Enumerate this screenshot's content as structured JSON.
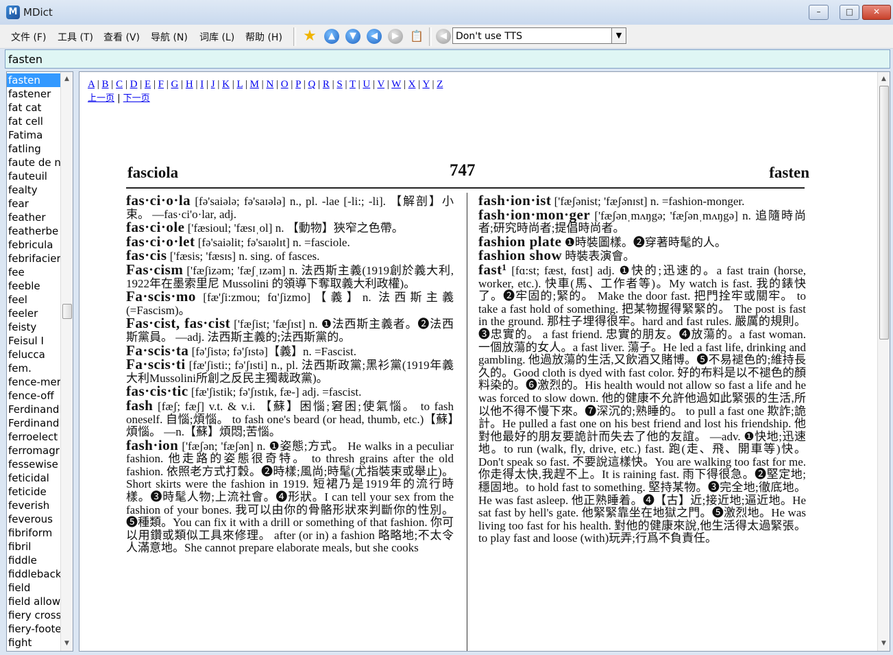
{
  "window": {
    "title": "MDict",
    "app_icon_glyph": "M"
  },
  "menu": [
    {
      "label": "文件 (F)"
    },
    {
      "label": "工具 (T)"
    },
    {
      "label": "查看 (V)"
    },
    {
      "label": "导航 (N)"
    },
    {
      "label": "词库 (L)"
    },
    {
      "label": "帮助 (H)"
    }
  ],
  "toolbar": {
    "tts_selected": "Don't use TTS"
  },
  "search": {
    "value": "fasten"
  },
  "wordlist": [
    "fasten",
    "fastener",
    "fat cat",
    "fat cell",
    "Fatima",
    "fatling",
    "faute de n",
    "fauteuil",
    "fealty",
    "fear",
    "feather",
    "featherbe",
    "febricula",
    "febrifacier",
    "fee",
    "feeble",
    "feel",
    "feeler",
    "feisty",
    "Feisul I",
    "felucca",
    "fem.",
    "fence-mer",
    "fence-off",
    "Ferdinand",
    "Ferdinand",
    "ferroelect",
    "ferromagr",
    "fessewise",
    "feticidal",
    "feticide",
    "feverish",
    "feverous",
    "fibriform",
    "fibril",
    "fiddle",
    "fiddleback",
    "field",
    "field allow",
    "fiery cross",
    "fiery-foote",
    "fight"
  ],
  "alphabet": [
    "A",
    "B",
    "C",
    "D",
    "E",
    "F",
    "G",
    "H",
    "I",
    "J",
    "K",
    "L",
    "M",
    "N",
    "O",
    "P",
    "Q",
    "R",
    "S",
    "T",
    "U",
    "V",
    "W",
    "X",
    "Y",
    "Z"
  ],
  "pager": {
    "prev": "上一页",
    "next": "下一页"
  },
  "page": {
    "header_left": "fasciola",
    "page_number": "747",
    "header_right": "fasten",
    "left_column": [
      {
        "hw": "fas·ci·o·la",
        "t": " [fə'saiələ; fə'saɪələ] n., pl. -lae [-li:; -li]. 【解剖】小束。 —fas·ci'o·lar, adj."
      },
      {
        "hw": "fas·ci·ole",
        "t": " ['fæsioul; 'fæsɪˌol] n. 【動物】狹窄之色帶。"
      },
      {
        "hw": "fas·ci·o·let",
        "t": " [fə'saiəlit; fə'saɪəlɪt] n. =fasciole."
      },
      {
        "hw": "fas·cis",
        "t": " ['fæsis; 'fæsɪs] n. sing. of fasces."
      },
      {
        "hw": "Fas·cism",
        "t": " ['fæʃizəm; 'fæʃˌɪzəm] n. 法西斯主義(1919創於義大利, 1922年在墨索里尼 Mussolini 的領導下奪取義大利政權)。"
      },
      {
        "hw": "Fa·scis·mo",
        "t": " [fæ'ʃi:zmou; fɑ'ʃizmo]【義】n. 法西斯主義 (=Fascism)。"
      },
      {
        "hw": "Fas·cist, fas·cist",
        "t": " ['fæʃist; 'fæʃɪst] n. ❶法西斯主義者。❷法西斯黨員。 —adj. 法西斯主義的;法西斯黨的。"
      },
      {
        "hw": "Fa·scis·ta",
        "t": " [fə'ʃistə; fə'ʃɪstə]【義】n. =Fascist."
      },
      {
        "hw": "Fa·scis·ti",
        "t": " [fæ'ʃisti:; fə'ʃɪsti] n., pl. 法西斯政黨;黑衫黨(1919年義大利Mussolini所創之反民主獨裁政黨)。"
      },
      {
        "hw": "fas·cis·tic",
        "t": " [fæ'ʃistik; fə'ʃɪstɪk, fæ-] adj. =fascist."
      },
      {
        "hw": "fash",
        "t": " [fæʃ; fæʃ] v.t. & v.i. 【蘇】困惱;窘困;使氣惱。 to fash oneself. 自惱;煩惱。 to fash one's beard (or head, thumb, etc.)【蘇】煩惱。 —n.【蘇】煩悶;苦惱。"
      },
      {
        "hw": "fash·ion",
        "t": " ['fæʃən; 'fæʃən] n. ❶姿態;方式。 He walks in a peculiar fashion. 他走路的姿態很奇特。 to thresh grains after the old fashion. 依照老方式打穀。❷時樣;風尚;時髦(尤指裝束或舉止)。Short skirts were the fashion in 1919. 短裙乃是1919年的流行時樣。❸時髦人物;上流社會。❹形狀。I can tell your sex from the fashion of your bones. 我可以由你的骨骼形狀來判斷你的性別。❺種類。You can fix it with a drill or something of that fashion. 你可以用鑽或類似工具來修理。 after (or in) a fashion 略略地;不太令人滿意地。She cannot prepare elaborate meals, but she cooks"
      }
    ],
    "right_column": [
      {
        "hw": "fash·ion·ist",
        "t": " ['fæʃənist; 'fæʃənɪst] n. =fashion-monger."
      },
      {
        "hw": "fash·ion·mon·ger",
        "t": " ['fæʃənˌmʌŋgə; 'fæʃənˌmʌŋgə] n. 追隨時尚者;研究時尚者;提倡時尚者。"
      },
      {
        "hw": "fashion plate",
        "t": " ❶時裝圖樣。❷穿著時髦的人。"
      },
      {
        "hw": "fashion show",
        "t": " 時裝表演會。"
      },
      {
        "hw": "fast¹",
        "t": " [fɑ:st; fæst, fɑst] adj. ❶快的;迅速的。a fast train (horse, worker, etc.). 快車(馬、工作者等)。My watch is fast. 我的錶快了。❷牢固的;緊的。 Make the door fast. 把門拴牢或關牢。 to take a fast hold of something. 把某物握得緊緊的。 The post is fast in the ground. 那柱子埋得很牢。hard and fast rules. 嚴厲的規則。❸忠實的。 a fast friend. 忠實的朋友。❹放蕩的。a fast woman. 一個放蕩的女人。a fast liver. 蕩子。He led a fast life, drinking and gambling. 他過放蕩的生活,又飲酒又賭博。❺不易褪色的;維持長久的。Good cloth is dyed with fast color. 好的布料是以不褪色的顏料染的。❻激烈的。His health would not allow so fast a life and he was forced to slow down. 他的健康不允許他過如此緊張的生活,所以他不得不慢下來。❼深沉的;熟睡的。 to pull a fast one 欺詐;詭計。He pulled a fast one on his best friend and lost his friendship. 他對他最好的朋友要詭計而失去了他的友誼。 —adv. ❶快地;迅速地。to run (walk, fly, drive, etc.) fast. 跑(走、飛、開車等)快。Don't speak so fast. 不要說這樣快。You are walking too fast for me. 你走得太快,我趕不上。It is raining fast. 雨下得很急。❷堅定地;穩固地。to hold fast to something. 堅持某物。❸完全地;徹底地。He was fast asleep. 他正熟睡着。❹【古】近;接近地;逼近地。He sat fast by hell's gate. 他緊緊靠坐在地獄之門。❺激烈地。He was living too fast for his health. 對他的健康來說,他生活得太過緊張。 to play fast and loose (with)玩弄;行爲不負責任。"
      }
    ]
  }
}
